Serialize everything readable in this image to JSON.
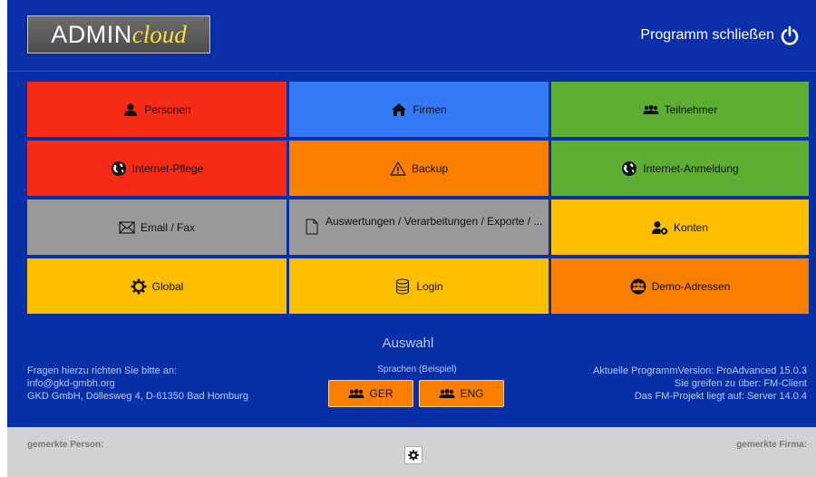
{
  "header": {
    "logo_admin": "ADMIN",
    "logo_cloud": "cloud",
    "close_label": "Programm schließen",
    "close_icon": "power-icon"
  },
  "tiles": [
    {
      "label": "Personen",
      "icon": "person-icon",
      "color": "#f52a17"
    },
    {
      "label": "Firmen",
      "icon": "home-icon",
      "color": "#3679f6"
    },
    {
      "label": "Teilnehmer",
      "icon": "group-icon",
      "color": "#5dae33"
    },
    {
      "label": "Internet-Pflege",
      "icon": "globe-icon",
      "color": "#f52a17"
    },
    {
      "label": "Backup",
      "icon": "warning-icon",
      "color": "#fa7f00"
    },
    {
      "label": "Internet-Anmeldung",
      "icon": "globe-icon",
      "color": "#5dae33"
    },
    {
      "label": "Email / Fax",
      "icon": "envelope-icon",
      "color": "#999999"
    },
    {
      "label": "Auswertungen / Verarbeitungen / Exporte / ...",
      "icon": "document-icon",
      "color": "#999999"
    },
    {
      "label": "Konten",
      "icon": "user-cog-icon",
      "color": "#fcbf00"
    },
    {
      "label": "Global",
      "icon": "gear-icon",
      "color": "#fcbf00"
    },
    {
      "label": "Login",
      "icon": "database-icon",
      "color": "#fcbf00"
    },
    {
      "label": "Demo-Adressen",
      "icon": "group-circle-icon",
      "color": "#fa7f00"
    }
  ],
  "auswahl": "Auswahl",
  "contact": {
    "line1": "Fragen hierzu richten Sie bitte an:",
    "line2": "info@gkd-gmbh.org",
    "line3": "GKD GmbH, Döllesweg 4, D-61350 Bad Homburg"
  },
  "languages": {
    "title": "Sprachen (Beispiel)",
    "ger": "GER",
    "eng": "ENG"
  },
  "version": {
    "line1": "Aktuelle ProgrammVersion: ProAdvanced 15.0.3",
    "line2": "Sie greifen zu über: FM-Client",
    "line3": "Das FM-Projekt liegt auf: Server 14.0.4"
  },
  "footer": {
    "person_label": "gemerkte Person:",
    "firma_label": "gemerkte Firma:"
  }
}
